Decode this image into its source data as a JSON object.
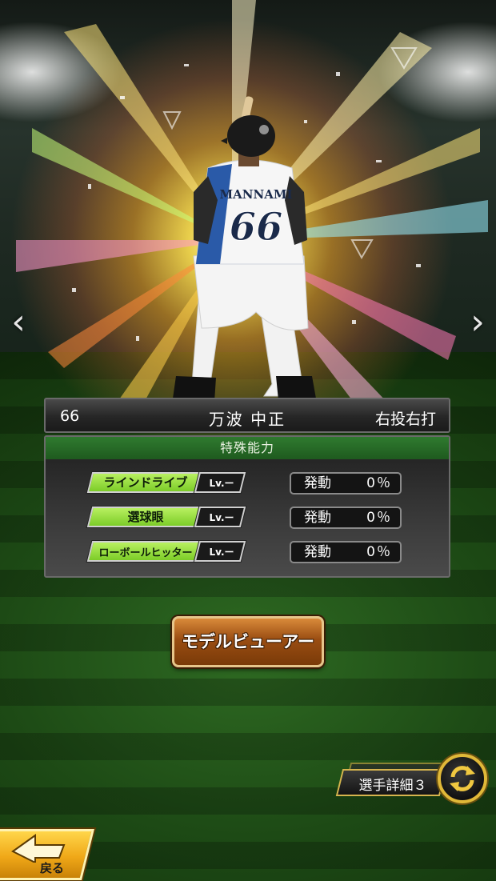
{
  "player": {
    "number": "66",
    "name": "万波 中正",
    "throw_bat": "右投右打",
    "jersey_name": "MANNAMI",
    "jersey_number": "66"
  },
  "abilities_panel": {
    "title": "特殊能力",
    "items": [
      {
        "name": "ラインドライブ",
        "level": "Lv.ー",
        "rate_label": "発動",
        "rate_value": "0％"
      },
      {
        "name": "選球眼",
        "level": "Lv.ー",
        "rate_label": "発動",
        "rate_value": "0％"
      },
      {
        "name": "ローボールヒッター",
        "level": "Lv.ー",
        "rate_label": "発動",
        "rate_value": "0％"
      }
    ]
  },
  "buttons": {
    "model_viewer": "モデルビューアー",
    "player_detail": "選手詳細３",
    "back": "戻る"
  },
  "nav": {
    "prev_icon": "chevron-left-icon",
    "next_icon": "chevron-right-icon",
    "prev_glyph": "‹",
    "next_glyph": "›"
  },
  "colors": {
    "ability_tag": "#8fd838",
    "header_green": "#2a6e2a",
    "button_brown": "#9a4d12",
    "gold": "#e0b838"
  }
}
